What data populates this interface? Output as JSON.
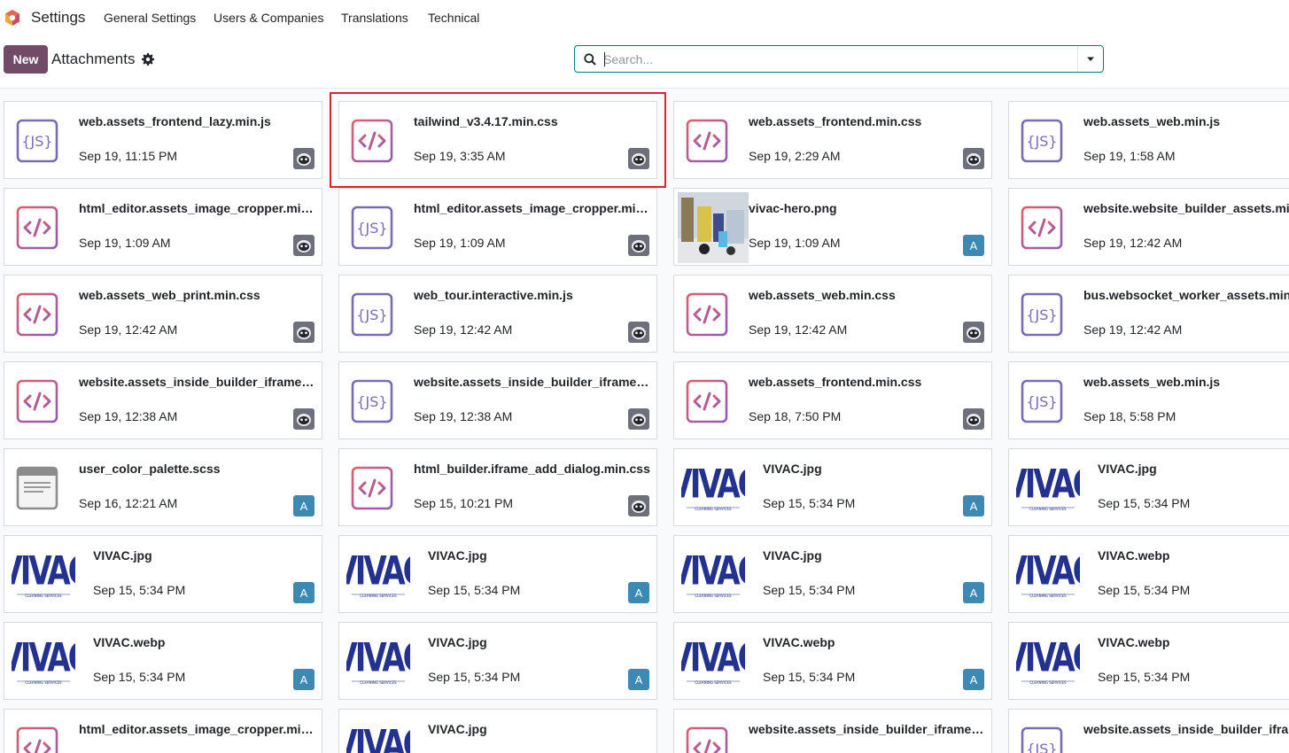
{
  "navbar": {
    "app_name": "Settings",
    "menu": [
      "General Settings",
      "Users & Companies",
      "Translations",
      "Technical"
    ]
  },
  "control_panel": {
    "new_label": "New",
    "breadcrumb": "Attachments",
    "search_placeholder": "Search..."
  },
  "colors": {
    "brand": "#714B67",
    "js_icon": "#7a6bb5",
    "code_icon_a": "#e05c6a",
    "code_icon_b": "#8e5cb7",
    "user_avatar": "#3c8ab3",
    "highlight": "#d9232e"
  },
  "cards": [
    {
      "name": "web.assets_frontend_lazy.min.js",
      "date": "Sep 19, 11:15 PM",
      "icon": "js-file-icon",
      "avatar": "bot"
    },
    {
      "name": "tailwind_v3.4.17.min.css",
      "date": "Sep 19, 3:35 AM",
      "icon": "code-file-icon",
      "avatar": "bot"
    },
    {
      "name": "web.assets_frontend.min.css",
      "date": "Sep 19, 2:29 AM",
      "icon": "code-file-icon",
      "avatar": "bot"
    },
    {
      "name": "web.assets_web.min.js",
      "date": "Sep 19, 1:58 AM",
      "icon": "js-file-icon",
      "avatar": "bot"
    },
    {
      "name": "html_editor.assets_image_cropper.min.css",
      "date": "Sep 19, 1:09 AM",
      "icon": "code-file-icon",
      "avatar": "bot"
    },
    {
      "name": "html_editor.assets_image_cropper.min.js",
      "date": "Sep 19, 1:09 AM",
      "icon": "js-file-icon",
      "avatar": "bot"
    },
    {
      "name": "vivac-hero.png",
      "date": "Sep 19, 1:09 AM",
      "icon": "photo-thumbnail",
      "avatar": "user",
      "avatar_letter": "A"
    },
    {
      "name": "website.website_builder_assets.min.css",
      "date": "Sep 19, 12:42 AM",
      "icon": "code-file-icon",
      "avatar": "bot"
    },
    {
      "name": "web.assets_web_print.min.css",
      "date": "Sep 19, 12:42 AM",
      "icon": "code-file-icon",
      "avatar": "bot"
    },
    {
      "name": "web_tour.interactive.min.js",
      "date": "Sep 19, 12:42 AM",
      "icon": "js-file-icon",
      "avatar": "bot"
    },
    {
      "name": "web.assets_web.min.css",
      "date": "Sep 19, 12:42 AM",
      "icon": "code-file-icon",
      "avatar": "bot"
    },
    {
      "name": "bus.websocket_worker_assets.min.js",
      "date": "Sep 19, 12:42 AM",
      "icon": "js-file-icon",
      "avatar": "bot"
    },
    {
      "name": "website.assets_inside_builder_iframe.min.css",
      "date": "Sep 19, 12:38 AM",
      "icon": "code-file-icon",
      "avatar": "bot"
    },
    {
      "name": "website.assets_inside_builder_iframe.min.js",
      "date": "Sep 19, 12:38 AM",
      "icon": "js-file-icon",
      "avatar": "bot"
    },
    {
      "name": "web.assets_frontend.min.css",
      "date": "Sep 18, 7:50 PM",
      "icon": "code-file-icon",
      "avatar": "bot"
    },
    {
      "name": "web.assets_web.min.js",
      "date": "Sep 18, 5:58 PM",
      "icon": "js-file-icon",
      "avatar": "bot"
    },
    {
      "name": "user_color_palette.scss",
      "date": "Sep 16, 12:21 AM",
      "icon": "text-file-icon",
      "avatar": "user",
      "avatar_letter": "A"
    },
    {
      "name": "html_builder.iframe_add_dialog.min.css",
      "date": "Sep 15, 10:21 PM",
      "icon": "code-file-icon",
      "avatar": "bot"
    },
    {
      "name": "VIVAC.jpg",
      "date": "Sep 15, 5:34 PM",
      "icon": "vivac-logo",
      "logo_text": "VIVAC",
      "logo_sub": "CLEANING SERVICES",
      "avatar": "user",
      "avatar_letter": "A"
    },
    {
      "name": "VIVAC.jpg",
      "date": "Sep 15, 5:34 PM",
      "icon": "vivac-logo",
      "logo_text": "VIVAC",
      "logo_sub": "CLEANING SERVICES",
      "avatar": "none"
    },
    {
      "name": "VIVAC.jpg",
      "date": "Sep 15, 5:34 PM",
      "icon": "vivac-logo",
      "logo_text": "VIVAC",
      "logo_sub": "CLEANING SERVICES",
      "avatar": "user",
      "avatar_letter": "A"
    },
    {
      "name": "VIVAC.jpg",
      "date": "Sep 15, 5:34 PM",
      "icon": "vivac-logo",
      "logo_text": "VIVAC",
      "logo_sub": "CLEANING SERVICES",
      "avatar": "user",
      "avatar_letter": "A"
    },
    {
      "name": "VIVAC.jpg",
      "date": "Sep 15, 5:34 PM",
      "icon": "vivac-logo",
      "logo_text": "VIVAC",
      "logo_sub": "CLEANING SERVICES",
      "avatar": "user",
      "avatar_letter": "A"
    },
    {
      "name": "VIVAC.webp",
      "date": "Sep 15, 5:34 PM",
      "icon": "vivac-logo",
      "logo_text": "VIVAC",
      "logo_sub": "CLEANING SERVICES",
      "avatar": "none"
    },
    {
      "name": "VIVAC.webp",
      "date": "Sep 15, 5:34 PM",
      "icon": "vivac-logo",
      "logo_text": "VIVAC",
      "logo_sub": "CLEANING SERVICES",
      "avatar": "user",
      "avatar_letter": "A"
    },
    {
      "name": "VIVAC.jpg",
      "date": "Sep 15, 5:34 PM",
      "icon": "vivac-logo",
      "logo_text": "VIVAC",
      "logo_sub": "CLEANING SERVICES",
      "avatar": "user",
      "avatar_letter": "A"
    },
    {
      "name": "VIVAC.webp",
      "date": "Sep 15, 5:34 PM",
      "icon": "vivac-logo",
      "logo_text": "VIVAC",
      "logo_sub": "CLEANING SERVICES",
      "avatar": "user",
      "avatar_letter": "A"
    },
    {
      "name": "VIVAC.webp",
      "date": "Sep 15, 5:34 PM",
      "icon": "vivac-logo",
      "logo_text": "VIVAC",
      "logo_sub": "CLEANING SERVICES",
      "avatar": "none"
    },
    {
      "name": "html_editor.assets_image_cropper.min.css",
      "date": "",
      "icon": "code-file-icon",
      "avatar": "bot"
    },
    {
      "name": "VIVAC.jpg",
      "date": "",
      "icon": "vivac-logo",
      "logo_text": "VIVAC",
      "logo_sub": "CLEANING SERVICES",
      "avatar": "user",
      "avatar_letter": "A"
    },
    {
      "name": "website.assets_inside_builder_iframe.min.css",
      "date": "",
      "icon": "code-file-icon",
      "avatar": "bot"
    },
    {
      "name": "website.assets_inside_builder_iframe.min.js",
      "date": "",
      "icon": "js-file-icon",
      "avatar": "bot"
    }
  ]
}
